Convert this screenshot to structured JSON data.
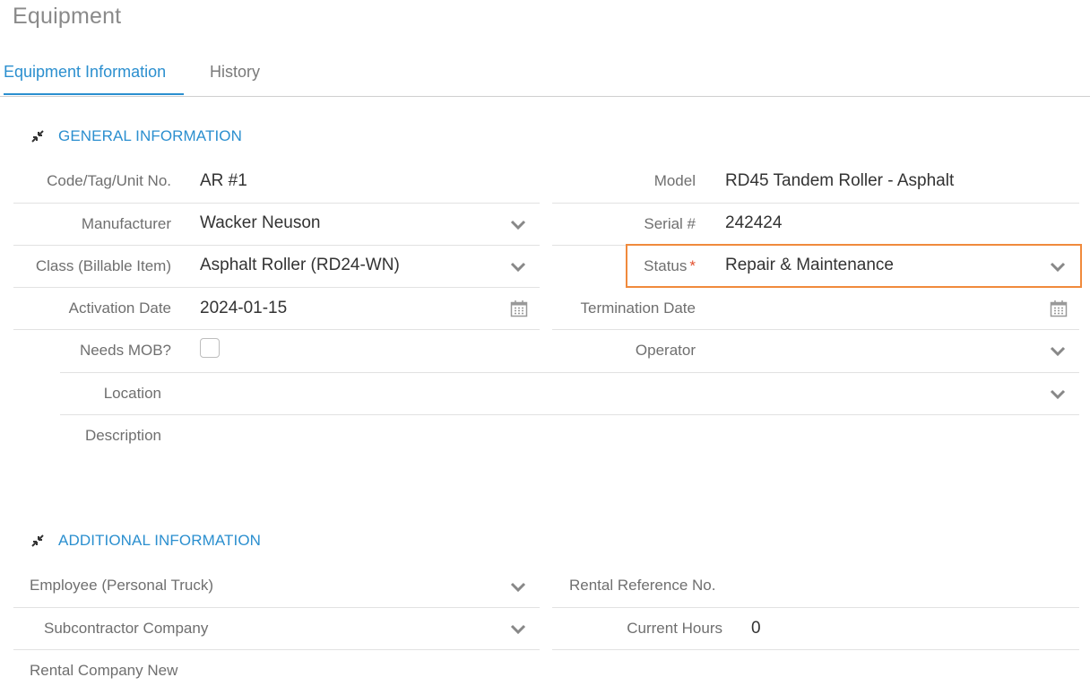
{
  "page": {
    "title": "Equipment"
  },
  "tabs": [
    {
      "label": "Equipment Information",
      "active": true
    },
    {
      "label": "History",
      "active": false
    }
  ],
  "general": {
    "title": "GENERAL INFORMATION",
    "icon": "collapse-arrows-icon",
    "fields": {
      "code": {
        "label": "Code/Tag/Unit No.",
        "value": "AR #1"
      },
      "manufacturer": {
        "label": "Manufacturer",
        "value": "Wacker Neuson"
      },
      "class": {
        "label": "Class (Billable Item)",
        "value": "Asphalt Roller (RD24-WN)"
      },
      "activation": {
        "label": "Activation Date",
        "value": "2024-01-15"
      },
      "needs_mob": {
        "label": "Needs MOB?",
        "checked": false
      },
      "location": {
        "label": "Location",
        "value": ""
      },
      "description": {
        "label": "Description",
        "value": ""
      },
      "model": {
        "label": "Model",
        "value": "RD45 Tandem Roller - Asphalt"
      },
      "serial": {
        "label": "Serial #",
        "value": "242424"
      },
      "status": {
        "label": "Status",
        "required_mark": "*",
        "value": "Repair & Maintenance"
      },
      "termination": {
        "label": "Termination Date",
        "value": ""
      },
      "operator": {
        "label": "Operator",
        "value": ""
      }
    }
  },
  "additional": {
    "title": "ADDITIONAL INFORMATION",
    "icon": "collapse-arrows-icon",
    "fields": {
      "employee": {
        "label": "Employee (Personal Truck)",
        "value": ""
      },
      "subcontractor": {
        "label": "Subcontractor Company",
        "value": ""
      },
      "rental_company": {
        "label": "Rental Company New",
        "value": ""
      },
      "rental_ref": {
        "label": "Rental Reference No.",
        "value": ""
      },
      "current_hours": {
        "label": "Current Hours",
        "value": "0"
      }
    }
  },
  "colors": {
    "accent": "#2b8fcf",
    "highlight": "#f08a3c",
    "required": "#e2502e"
  }
}
